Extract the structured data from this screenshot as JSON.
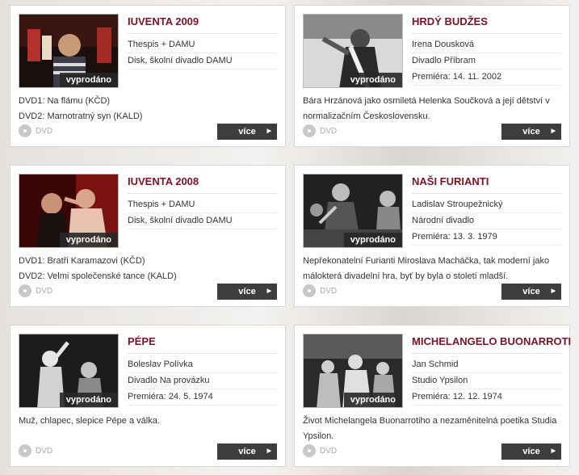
{
  "cards": [
    {
      "title": "IUVENTA 2009",
      "lines": [
        "Thespis + DAMU",
        "Disk, školní divadlo DAMU",
        ""
      ],
      "desc": [
        "DVD1: Na flámu (KČD)",
        "DVD2: Marnotratný syn (KALD)"
      ],
      "status": "vyprodáno",
      "format": "DVD",
      "more": "více"
    },
    {
      "title": "HRDÝ BUDŽES",
      "lines": [
        "Irena Dousková",
        "Divadlo Příbram",
        "Premiéra: 14. 11. 2002"
      ],
      "desc": [
        "Bára Hrzánová jako osmiletá Helenka Součková a její dětství v",
        "normalizačním Československu."
      ],
      "status": "vyprodáno",
      "format": "DVD",
      "more": "více"
    },
    {
      "title": "IUVENTA 2008",
      "lines": [
        "Thespis + DAMU",
        "Disk, školní divadlo DAMU",
        ""
      ],
      "desc": [
        "DVD1: Bratři Karamazovi (KČD)",
        "DVD2: Velmi společenské tance (KALD)"
      ],
      "status": "vyprodáno",
      "format": "DVD",
      "more": "více"
    },
    {
      "title": "NAŠI FURIANTI",
      "lines": [
        "Ladislav Stroupežnický",
        "Národní divadlo",
        "Premiéra: 13. 3. 1979"
      ],
      "desc": [
        "Nepřekonatelní Furianti Miroslava Macháčka, tak moderní jako",
        "málokterá divadelní hra, byť by byla o století mladší."
      ],
      "status": "vyprodáno",
      "format": "DVD",
      "more": "více"
    },
    {
      "title": "PÉPE",
      "lines": [
        "Boleslav Polívka",
        "Divadlo Na provázku",
        "Premiéra: 24. 5. 1974"
      ],
      "desc": [
        "Muž, chlapec, slepice Pépe a válka.",
        ""
      ],
      "status": "vyprodáno",
      "format": "DVD",
      "more": "více"
    },
    {
      "title": "MICHELANGELO BUONARROTI",
      "lines": [
        "Jan Schmid",
        "Studio Ypsilon",
        "Premiéra: 12. 12. 1974"
      ],
      "desc": [
        "Život Michelangela Buonarrotiho a nezaměnitelná poetika Studia",
        "Ypsilon."
      ],
      "status": "vyprodáno",
      "format": "DVD",
      "more": "více"
    }
  ],
  "colors": {
    "title": "#7a1426",
    "button": "#3d3d3d"
  },
  "icons": {
    "disc": "dvd-disc-icon",
    "arrow": "arrow-right-icon"
  }
}
